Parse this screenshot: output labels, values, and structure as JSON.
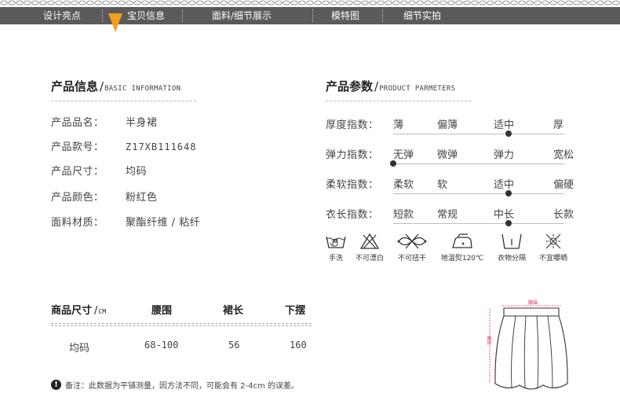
{
  "nav": {
    "tabs": [
      "设计亮点",
      "宝贝信息",
      "面料/细节展示",
      "模特图",
      "细节实拍"
    ],
    "active_index": 1,
    "bar_color": "#5a5a5a",
    "arrow_color": "#f2a01e"
  },
  "product_info": {
    "title": "产品信息",
    "title_en": "BASIC INFORMATION",
    "rows": [
      {
        "label": "产品品名：",
        "value": "半身裙"
      },
      {
        "label": "产品款号：",
        "value": "Z17XB111648"
      },
      {
        "label": "产品尺寸：",
        "value": "均码"
      },
      {
        "label": "产品颜色：",
        "value": "粉红色"
      },
      {
        "label": "面料材质：",
        "value": "聚酯纤维 / 粘纤"
      }
    ]
  },
  "product_params": {
    "title": "产品参数",
    "title_en": "PRODUCT PARMETERS",
    "rows": [
      {
        "label": "厚度指数：",
        "options": [
          "薄",
          "偏薄",
          "适中",
          "厚"
        ],
        "selected_index": 2
      },
      {
        "label": "弹力指数：",
        "options": [
          "无弹",
          "微弹",
          "弹力",
          "宽松"
        ],
        "selected_index": 0
      },
      {
        "label": "柔软指数：",
        "options": [
          "柔软",
          "软",
          "适中",
          "偏硬"
        ],
        "selected_index": 2
      },
      {
        "label": "衣长指数：",
        "options": [
          "短款",
          "常规",
          "中长",
          "长款"
        ],
        "selected_index": 2
      }
    ]
  },
  "care": [
    {
      "icon": "hand-wash-icon",
      "label": "手洗"
    },
    {
      "icon": "no-bleach-icon",
      "label": "不可漂白"
    },
    {
      "icon": "no-wring-icon",
      "label": "不可扭干"
    },
    {
      "icon": "low-iron-icon",
      "label": "地温熨120℃"
    },
    {
      "icon": "separate-wash-icon",
      "label": "衣物分隔"
    },
    {
      "icon": "no-sun-dry-icon",
      "label": "不宜曝晒"
    }
  ],
  "size_table": {
    "header_label": "商品尺寸",
    "unit": "CM",
    "columns": [
      "腰围",
      "裙长",
      "下摆"
    ],
    "rows": [
      {
        "size": "均码",
        "values": [
          "68-100",
          "56",
          "160"
        ]
      }
    ]
  },
  "note": "备注：此数据为平铺测量，因方法不同，可能会有 2-4cm 的误差。",
  "diagram": {
    "waist_label": "腰围",
    "length_label": "裙长",
    "marker_color": "#e0306a"
  }
}
